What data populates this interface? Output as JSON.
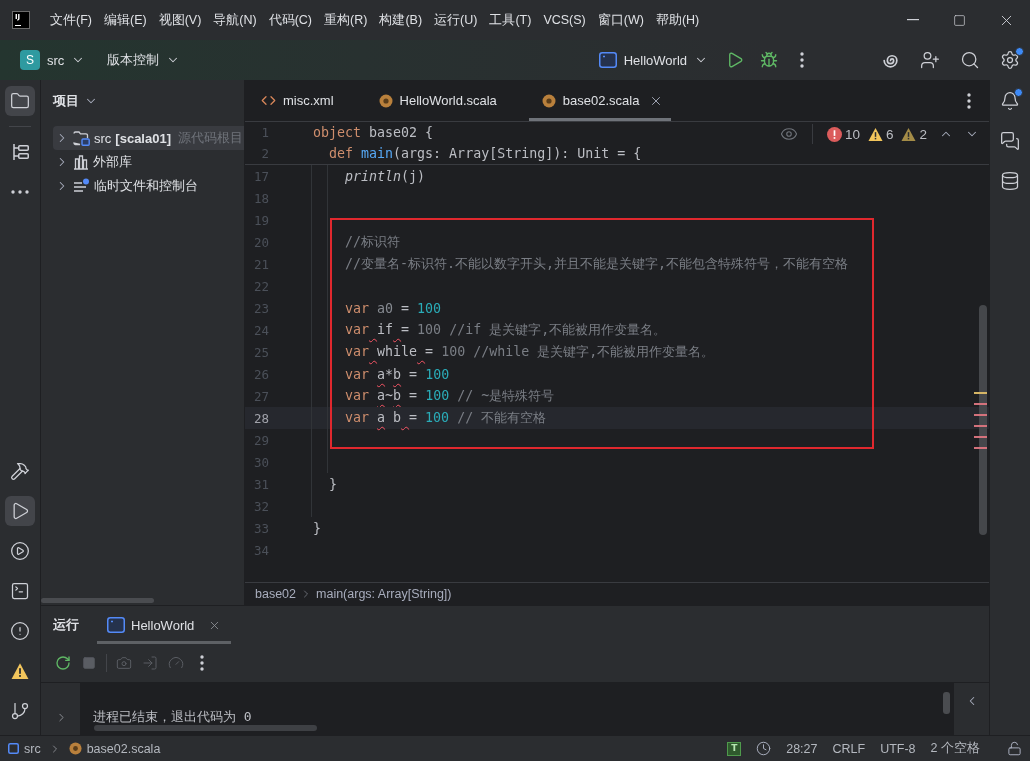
{
  "title_bar": {
    "logo": "IJ",
    "menu": [
      "文件(F)",
      "编辑(E)",
      "视图(V)",
      "导航(N)",
      "代码(C)",
      "重构(R)",
      "构建(B)",
      "运行(U)",
      "工具(T)",
      "VCS(S)",
      "窗口(W)",
      "帮助(H)"
    ]
  },
  "toolbar": {
    "project_initial": "S",
    "project": "src",
    "vcs": "版本控制",
    "run_config": "HelloWorld",
    "settings_badge": true
  },
  "left_strip": {
    "top": [
      {
        "kind": "project",
        "selected": true
      },
      {
        "kind": "structure",
        "selected": false
      },
      {
        "kind": "more",
        "selected": false
      }
    ],
    "bottom": [
      {
        "kind": "build",
        "selected": false
      },
      {
        "kind": "run",
        "selected": true
      },
      {
        "kind": "services",
        "selected": false
      },
      {
        "kind": "terminal",
        "selected": false
      },
      {
        "kind": "problems",
        "selected": false
      },
      {
        "kind": "alerts",
        "selected": false
      },
      {
        "kind": "git",
        "selected": false
      }
    ]
  },
  "project_panel": {
    "title": "项目",
    "items": [
      {
        "kind": "source",
        "label": "src",
        "module": "[scala01]",
        "hint": "源代码根目",
        "expanded": false,
        "selected": true
      },
      {
        "kind": "library",
        "label": "外部库",
        "expanded": false,
        "selected": false
      },
      {
        "kind": "scratches",
        "label": "临时文件和控制台",
        "expanded": false,
        "selected": false
      }
    ]
  },
  "editor": {
    "tabs": [
      {
        "kind": "xml",
        "label": "misc.xml",
        "selected": false
      },
      {
        "kind": "scala",
        "label": "HelloWorld.scala",
        "selected": false
      },
      {
        "kind": "scala",
        "label": "base02.scala",
        "selected": true
      }
    ],
    "inspections": [
      {
        "kind": "error",
        "count": "10"
      },
      {
        "kind": "warning",
        "count": "6"
      },
      {
        "kind": "weak",
        "count": "2"
      }
    ],
    "sticky_lines": [
      {
        "number": "1",
        "tokens": [
          {
            "text": "object",
            "kind": "keyword"
          },
          {
            "text": " base02 {",
            "kind": "plain"
          }
        ]
      },
      {
        "number": "2",
        "tokens": [
          {
            "text": "  def ",
            "kind": "keyword"
          },
          {
            "text": "main",
            "kind": "function"
          },
          {
            "text": "(args: Array[String]): Unit = {",
            "kind": "plain"
          }
        ]
      }
    ],
    "lines": [
      {
        "number": "17",
        "current": false,
        "tokens": [
          {
            "text": "    println",
            "kind": "italic"
          },
          {
            "text": "(j)",
            "kind": "plain"
          }
        ]
      },
      {
        "number": "18",
        "current": false
      },
      {
        "number": "19",
        "current": false
      },
      {
        "number": "20",
        "current": false,
        "tokens": [
          {
            "text": "    //标识符",
            "kind": "comment"
          }
        ]
      },
      {
        "number": "21",
        "current": false,
        "tokens": [
          {
            "text": "    //变量名-标识符.不能以数字开头,并且不能是关键字,不能包含特殊符号，不能有空格",
            "kind": "comment"
          }
        ]
      },
      {
        "number": "22",
        "current": false
      },
      {
        "number": "23",
        "current": false,
        "tokens": [
          {
            "text": "    var ",
            "kind": "keyword"
          },
          {
            "text": "a0",
            "kind": "unused"
          },
          {
            "text": " = ",
            "kind": "plain"
          },
          {
            "text": "100",
            "kind": "number"
          }
        ]
      },
      {
        "number": "24",
        "current": false,
        "tokens": [
          {
            "text": "    var ",
            "kind": "keyword",
            "squiggle": true
          },
          {
            "text": "if ",
            "kind": "plain",
            "squiggle": true
          },
          {
            "text": "= ",
            "kind": "plain",
            "squiggle": false
          },
          {
            "text": "100 //if 是关键字,不能被用作变量名。",
            "kind": "comment",
            "squiggle": false
          }
        ]
      },
      {
        "number": "25",
        "current": false,
        "tokens": [
          {
            "text": "    var ",
            "kind": "keyword",
            "squiggle": true
          },
          {
            "text": "while ",
            "kind": "plain",
            "squiggle": true
          },
          {
            "text": "= ",
            "kind": "plain",
            "squiggle": false
          },
          {
            "text": "100 //while 是关键字,不能被用作变量名。",
            "kind": "comment",
            "squiggle": false
          }
        ]
      },
      {
        "number": "26",
        "current": false,
        "tokens": [
          {
            "text": "    var ",
            "kind": "keyword",
            "squiggle": false
          },
          {
            "text": "a",
            "kind": "plain",
            "squiggle": true
          },
          {
            "text": "*",
            "kind": "plain",
            "squiggle": false
          },
          {
            "text": "b",
            "kind": "plain",
            "squiggle": true
          },
          {
            "text": " = ",
            "kind": "plain",
            "squiggle": false
          },
          {
            "text": "100",
            "kind": "number",
            "squiggle": false
          }
        ]
      },
      {
        "number": "27",
        "current": false,
        "tokens": [
          {
            "text": "    var ",
            "kind": "keyword",
            "squiggle": false
          },
          {
            "text": "a",
            "kind": "plain",
            "squiggle": true
          },
          {
            "text": "~",
            "kind": "plain",
            "squiggle": false
          },
          {
            "text": "b",
            "kind": "plain",
            "squiggle": true
          },
          {
            "text": " = ",
            "kind": "plain",
            "squiggle": false
          },
          {
            "text": "100",
            "kind": "number",
            "squiggle": false
          },
          {
            "text": " // ~是特殊符号",
            "kind": "comment",
            "squiggle": false
          }
        ]
      },
      {
        "number": "28",
        "current": true,
        "tokens": [
          {
            "text": "    var ",
            "kind": "keyword",
            "squiggle": false
          },
          {
            "text": "a",
            "kind": "plain",
            "squiggle": true
          },
          {
            "text": " b ",
            "kind": "plain",
            "squiggle": true
          },
          {
            "text": "= ",
            "kind": "plain",
            "squiggle": false
          },
          {
            "text": "100",
            "kind": "number",
            "squiggle": false
          },
          {
            "text": " // 不能有空格",
            "kind": "comment",
            "squiggle": false
          }
        ]
      },
      {
        "number": "29",
        "current": false
      },
      {
        "number": "30",
        "current": false
      },
      {
        "number": "31",
        "current": false,
        "tokens": [
          {
            "text": "  }",
            "kind": "plain"
          }
        ]
      },
      {
        "number": "32",
        "current": false
      },
      {
        "number": "33",
        "current": false,
        "tokens": [
          {
            "text": "}",
            "kind": "plain"
          }
        ]
      },
      {
        "number": "34",
        "current": false
      }
    ],
    "breadcrumbs": [
      "base02",
      "main(args: Array[String])"
    ]
  },
  "run_panel": {
    "title": "运行",
    "tabs": [
      {
        "label": "HelloWorld",
        "selected": true
      }
    ],
    "actions": [
      {
        "kind": "rerun",
        "disabled": false
      },
      {
        "kind": "stop",
        "disabled": true
      },
      {
        "kind": "screenshot",
        "disabled": true
      },
      {
        "kind": "exit",
        "disabled": true
      },
      {
        "kind": "profile",
        "disabled": true
      },
      {
        "kind": "more",
        "disabled": false
      }
    ],
    "output": [
      {
        "text": "进程已结束，退出代码为 0",
        "expanded": false
      }
    ]
  },
  "right_strip": [
    {
      "kind": "notifications",
      "badge": true
    },
    {
      "kind": "assistant",
      "badge": false
    },
    {
      "kind": "database",
      "badge": false
    }
  ],
  "status_bar": {
    "path": [
      {
        "kind": "module",
        "label": "src"
      },
      {
        "kind": "scala",
        "label": "base02.scala"
      }
    ],
    "plugin": "T",
    "position": "28:27",
    "line_separator": "CRLF",
    "encoding": "UTF-8",
    "indent": "2 个空格"
  }
}
